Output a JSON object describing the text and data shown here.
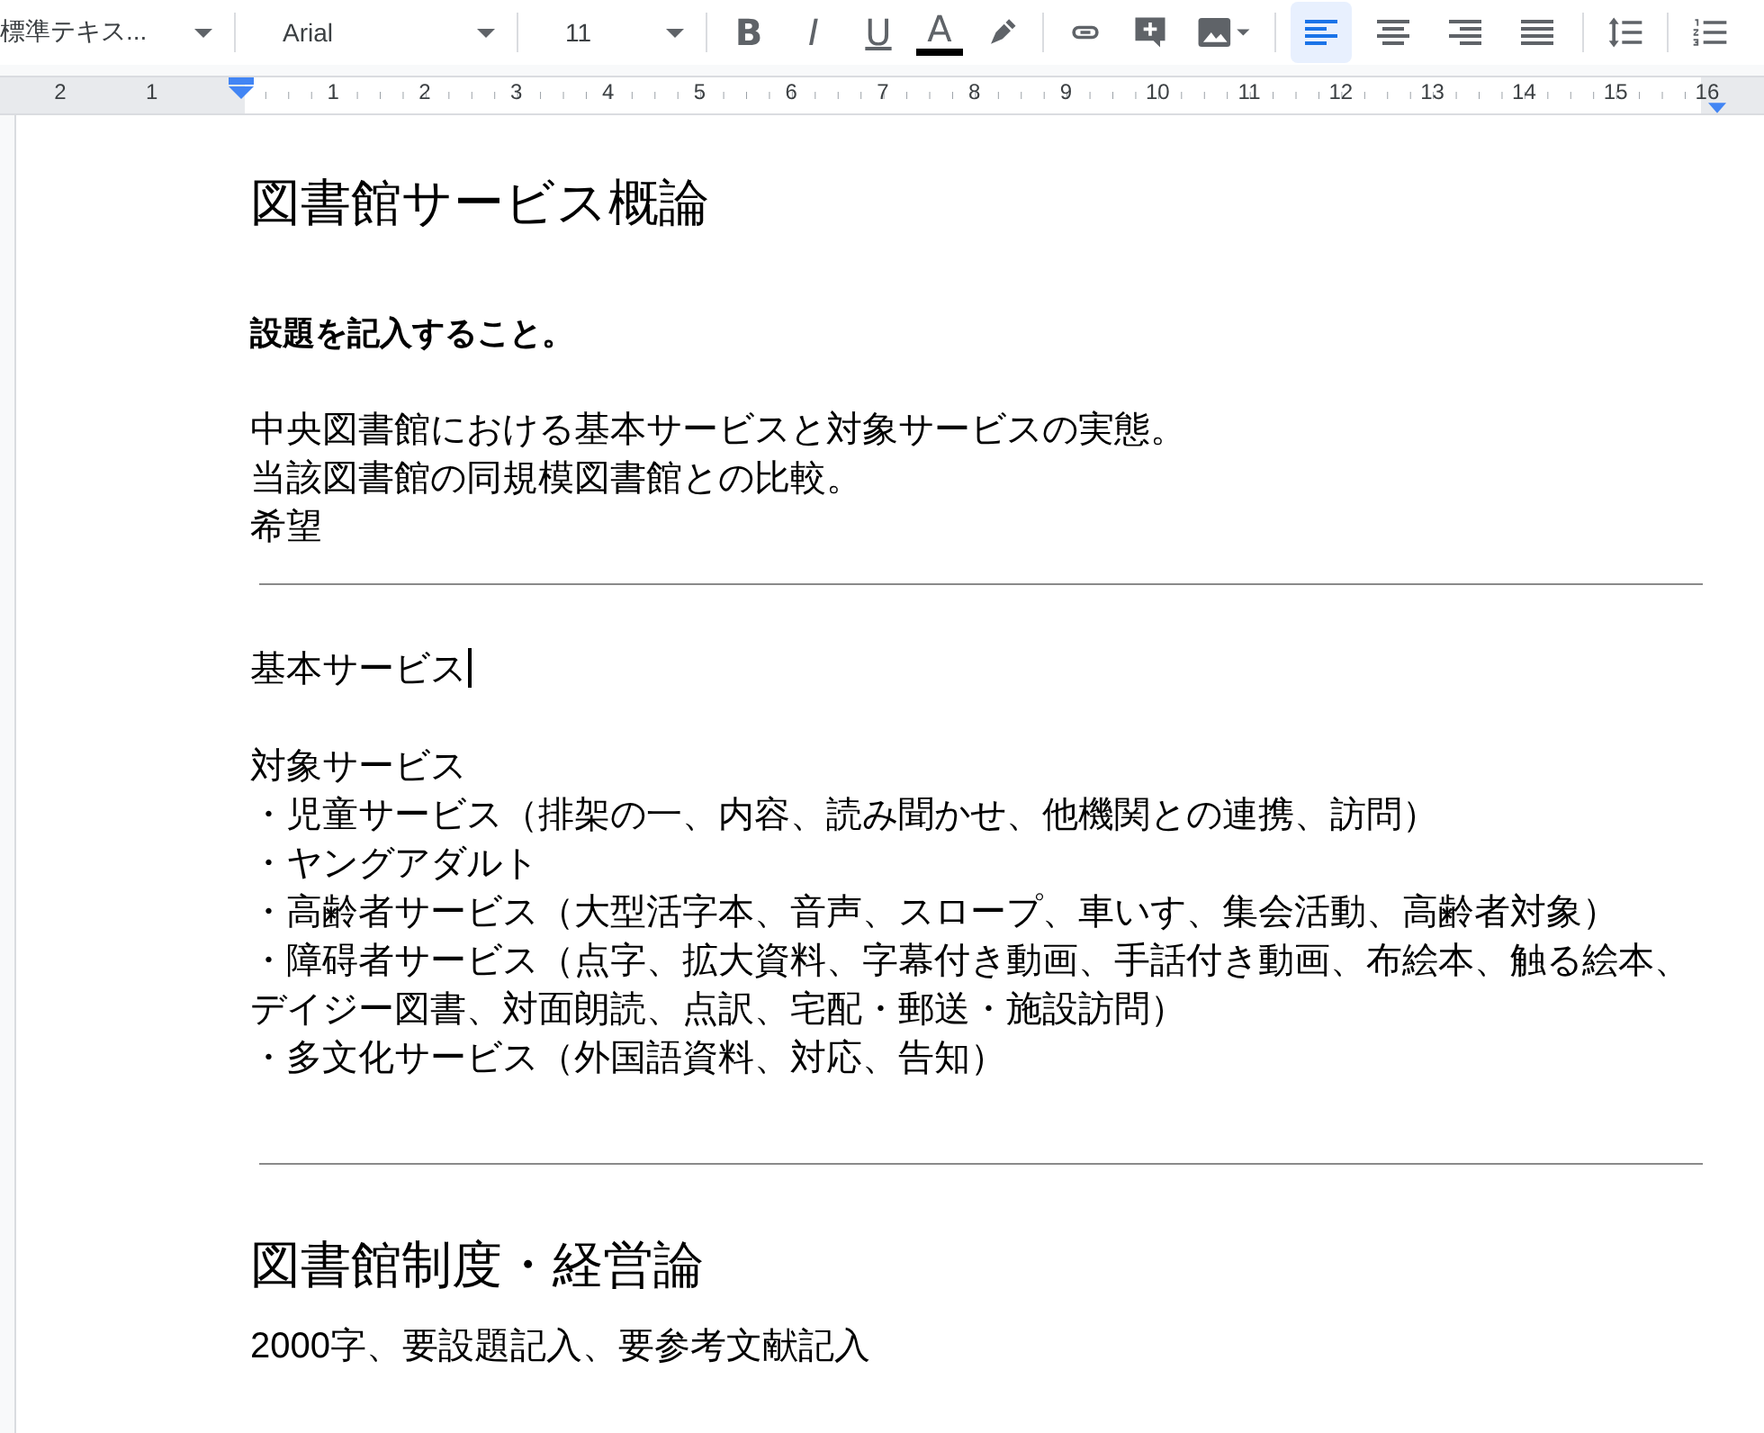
{
  "toolbar": {
    "style_dropdown": "標準テキス...",
    "font_dropdown": "Arial",
    "size_dropdown": "11",
    "format_buttons": [
      {
        "kind": "bold",
        "label": "B"
      },
      {
        "kind": "italic",
        "label": "I"
      },
      {
        "kind": "underline",
        "label": "U"
      },
      {
        "kind": "textcolor",
        "label": "A"
      }
    ],
    "align_buttons": [
      {
        "kind": "left",
        "selected": true
      },
      {
        "kind": "center",
        "selected": false
      },
      {
        "kind": "right",
        "selected": false
      },
      {
        "kind": "justify",
        "selected": false
      }
    ]
  },
  "ruler": {
    "left_labels": [
      "2",
      "1"
    ],
    "right_labels": [
      "1",
      "2",
      "3",
      "4",
      "5",
      "6",
      "7",
      "8",
      "9",
      "10",
      "11",
      "12",
      "13",
      "14",
      "15",
      "16"
    ]
  },
  "document": [
    {
      "kind": "title",
      "text": "図書館サービス概論"
    },
    {
      "kind": "gap"
    },
    {
      "kind": "bold",
      "text": "設題を記入すること。"
    },
    {
      "kind": "gap"
    },
    {
      "kind": "text",
      "text": "中央図書館における基本サービスと対象サービスの実態。",
      "cursor": false
    },
    {
      "kind": "text",
      "text": "当該図書館の同規模図書館との比較。",
      "cursor": false
    },
    {
      "kind": "text",
      "text": "希望",
      "cursor": false
    },
    {
      "kind": "rule"
    },
    {
      "kind": "text",
      "text": "基本サービス",
      "cursor": true
    },
    {
      "kind": "gap"
    },
    {
      "kind": "text",
      "text": "対象サービス",
      "cursor": false
    },
    {
      "kind": "text",
      "text": "・児童サービス（排架の一、内容、読み聞かせ、他機関との連携、訪問）",
      "cursor": false
    },
    {
      "kind": "text",
      "text": "・ヤングアダルト",
      "cursor": false
    },
    {
      "kind": "text",
      "text": "・高齢者サービス（大型活字本、音声、スロープ、車いす、集会活動、高齢者対象）",
      "cursor": false
    },
    {
      "kind": "text",
      "text": "・障碍者サービス（点字、拡大資料、字幕付き動画、手話付き動画、布絵本、触る絵本、デイジー図書、対面朗読、点訳、宅配・郵送・施設訪問）",
      "cursor": false
    },
    {
      "kind": "text",
      "text": "・多文化サービス（外国語資料、対応、告知）",
      "cursor": false
    },
    {
      "kind": "gap"
    },
    {
      "kind": "rule"
    },
    {
      "kind": "title",
      "text": "図書館制度・経営論"
    },
    {
      "kind": "text",
      "text": "2000字、要設題記入、要参考文献記入",
      "cursor": false
    }
  ]
}
